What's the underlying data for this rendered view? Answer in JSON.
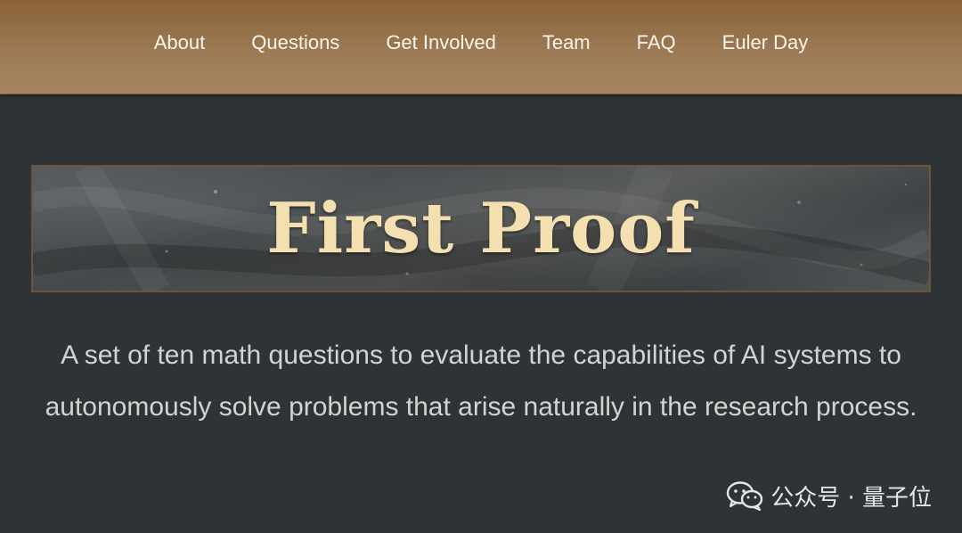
{
  "nav": {
    "items": [
      {
        "label": "About"
      },
      {
        "label": "Questions"
      },
      {
        "label": "Get Involved"
      },
      {
        "label": "Team"
      },
      {
        "label": "FAQ"
      },
      {
        "label": "Euler Day"
      }
    ]
  },
  "hero": {
    "title": "First Proof"
  },
  "description": "A set of ten math questions to evaluate the capabilities of AI systems to autonomously solve problems that arise naturally in the research process.",
  "watermark": {
    "icon": "wechat-icon",
    "text": "公众号 · 量子位"
  },
  "colors": {
    "nav_background": "#9c7a55",
    "page_background": "#2d3337",
    "title_color": "#f3dfb0",
    "description_color": "#d3d4cf"
  }
}
